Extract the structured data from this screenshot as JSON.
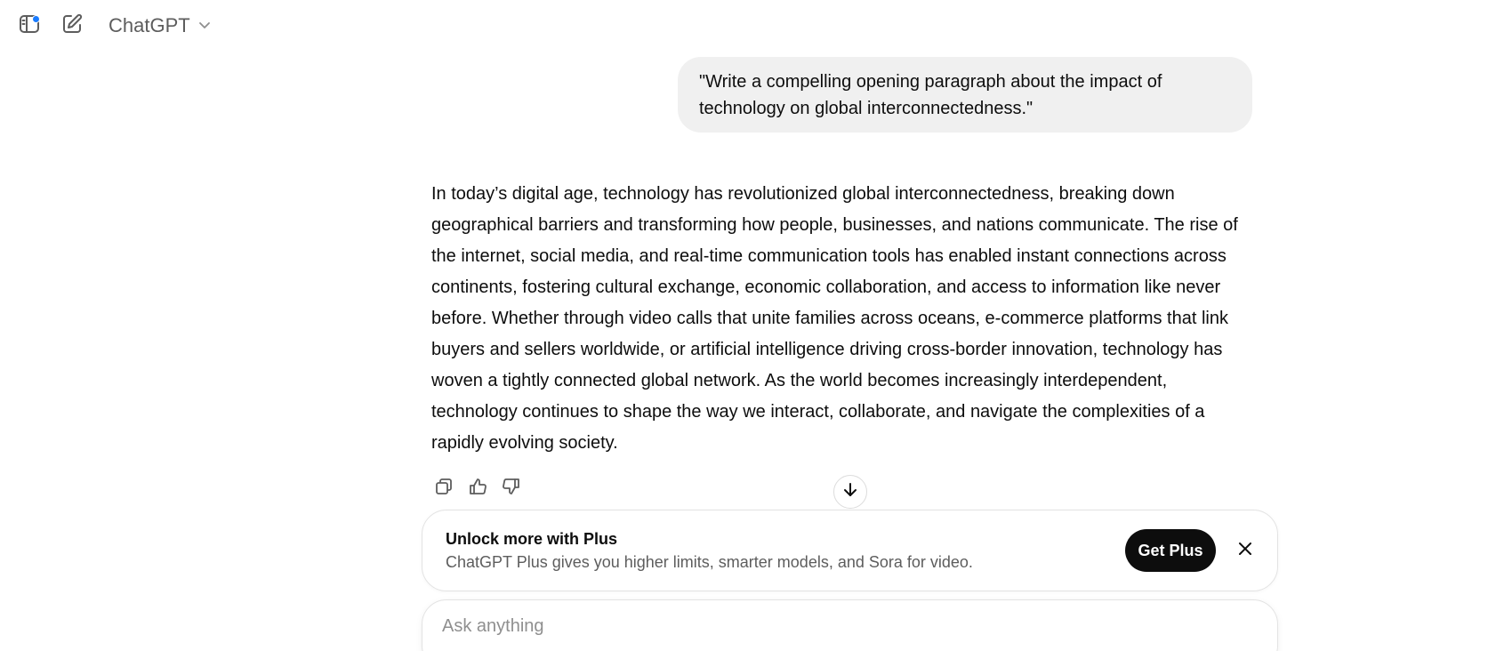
{
  "header": {
    "model_name": "ChatGPT",
    "notification_color": "#1a7cff"
  },
  "conversation": {
    "user_message": "\"Write a compelling opening paragraph about the impact of technology on global interconnectedness.\"",
    "assistant_message": "In today’s digital age, technology has revolutionized global interconnectedness, breaking down geographical barriers and transforming how people, businesses, and nations communicate. The rise of the internet, social media, and real-time communication tools has enabled instant connections across continents, fostering cultural exchange, economic collaboration, and access to information like never before. Whether through video calls that unite families across oceans, e-commerce platforms that link buyers and sellers worldwide, or artificial intelligence driving cross-border innovation, technology has woven a tightly connected global network. As the world becomes increasingly interdependent, technology continues to shape the way we interact, collaborate, and navigate the complexities of a rapidly evolving society."
  },
  "actions": [
    "copy-icon",
    "thumbs-up-icon",
    "thumbs-down-icon"
  ],
  "plus_banner": {
    "title": "Unlock more with Plus",
    "subtitle": "ChatGPT Plus gives you higher limits, smarter models, and Sora for video.",
    "button_label": "Get Plus"
  },
  "composer": {
    "placeholder": "Ask anything",
    "value": ""
  }
}
